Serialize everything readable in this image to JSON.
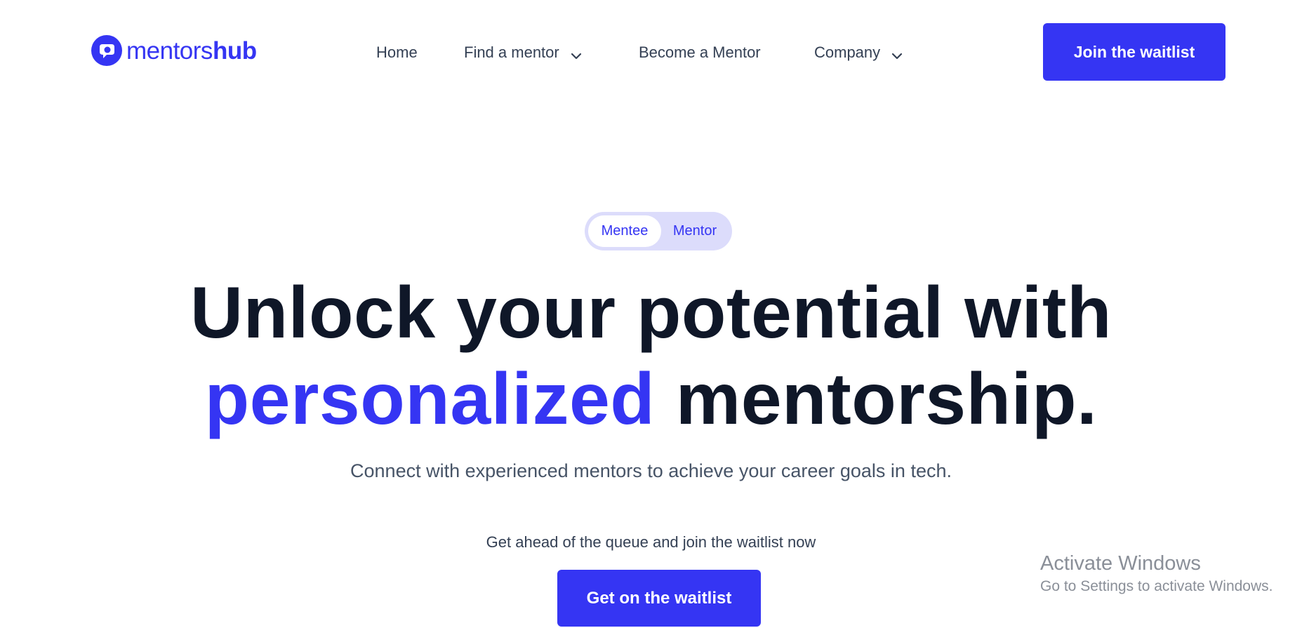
{
  "header": {
    "logo": {
      "text_light": "mentors",
      "text_bold": "hub"
    },
    "nav": [
      {
        "label": "Home",
        "has_dropdown": false
      },
      {
        "label": "Find a mentor",
        "has_dropdown": true
      },
      {
        "label": "Become a Mentor",
        "has_dropdown": false
      },
      {
        "label": "Company",
        "has_dropdown": true
      }
    ],
    "cta_label": "Join the waitlist"
  },
  "hero": {
    "toggle": {
      "options": [
        "Mentee",
        "Mentor"
      ],
      "selected": "Mentee"
    },
    "headline_line1": "Unlock your potential with",
    "headline_accent": "personalized",
    "headline_rest": " mentorship.",
    "subheadline": "Connect with experienced mentors to achieve your career goals in tech.",
    "cta_note": "Get ahead of the queue and join the waitlist now",
    "cta_label": "Get on the waitlist"
  },
  "watermark": {
    "title": "Activate Windows",
    "subtitle": "Go to Settings to activate Windows."
  },
  "colors": {
    "brand": "#3535f3",
    "headline": "#0f1728",
    "toggle_bg": "#dcdcfb",
    "body_text": "#475467"
  },
  "icons": {
    "logo": "mentorshub-logo-icon",
    "dropdown": "chevron-down-icon"
  }
}
